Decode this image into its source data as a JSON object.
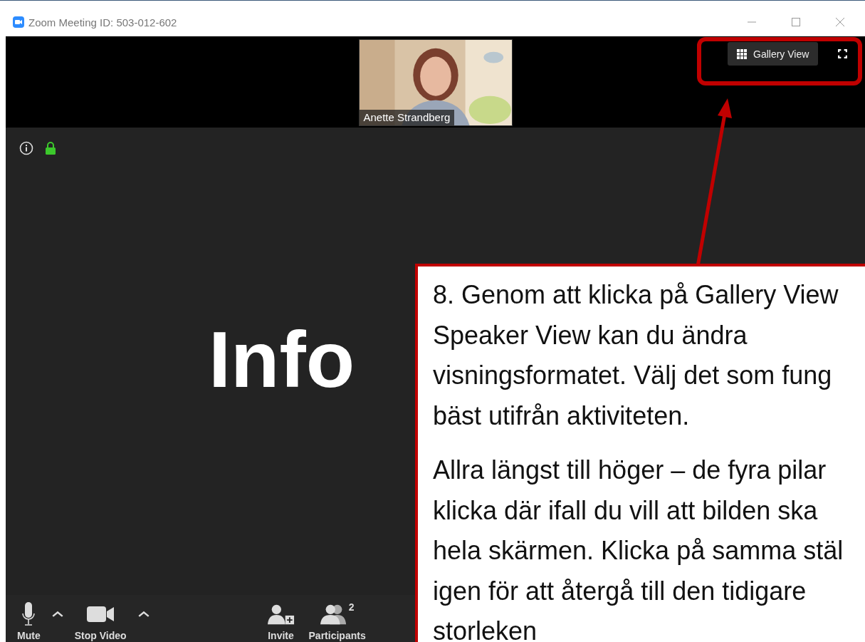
{
  "window": {
    "title": "Zoom Meeting ID: 503-012-602"
  },
  "video_strip": {
    "participant": {
      "name": "Anette Strandberg",
      "kind": "picture"
    },
    "view_button": {
      "label": "Gallery View"
    }
  },
  "main_video": {
    "text": "Info"
  },
  "toolbar": {
    "items": [
      {
        "label": "Mute",
        "kind": "mic",
        "menu": true
      },
      {
        "label": "Stop Video",
        "kind": "video",
        "menu": true
      },
      {
        "label": "Invite",
        "kind": "invite",
        "menu": false
      },
      {
        "label": "Participants",
        "kind": "participants",
        "count": "2",
        "menu": false
      }
    ]
  },
  "callout": {
    "paragraphs": [
      [
        "8. Genom att klicka på Gallery View",
        "Speaker View kan du ändra",
        "visningsformatet. Välj det som fung",
        "bäst utifrån aktiviteten."
      ],
      [
        "Allra längst till höger – de fyra pilar",
        "klicka där ifall du vill att bilden ska",
        "hela skärmen. Klicka på samma stäl",
        "igen för att återgå till den tidigare",
        "storleken"
      ]
    ]
  }
}
